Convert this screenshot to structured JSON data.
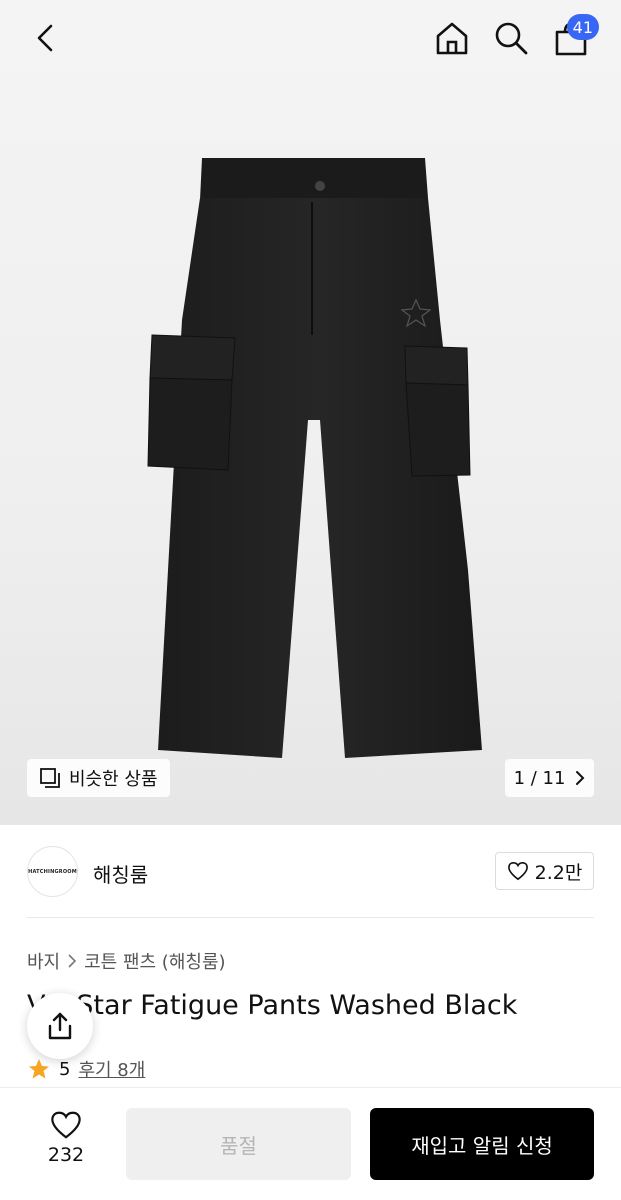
{
  "header": {
    "cart_count": "41",
    "badge_color": "#3866f5"
  },
  "gallery": {
    "similar_label": "비슷한 상품",
    "pager": "1 / 11"
  },
  "brand": {
    "logo_text": "HATCHINGROOM",
    "name": "해칭룸",
    "likes": "2.2만"
  },
  "breadcrumb": {
    "category": "바지",
    "subcategory": "코튼 팬츠 (해칭룸)"
  },
  "product": {
    "title": "V.S Star Fatigue Pants Washed Black",
    "rating": "5",
    "reviews": "후기 8개",
    "star_color": "#f5a623"
  },
  "bottom": {
    "fav_count": "232",
    "soldout_label": "품절",
    "restock_label": "재입고 알림 신청"
  }
}
